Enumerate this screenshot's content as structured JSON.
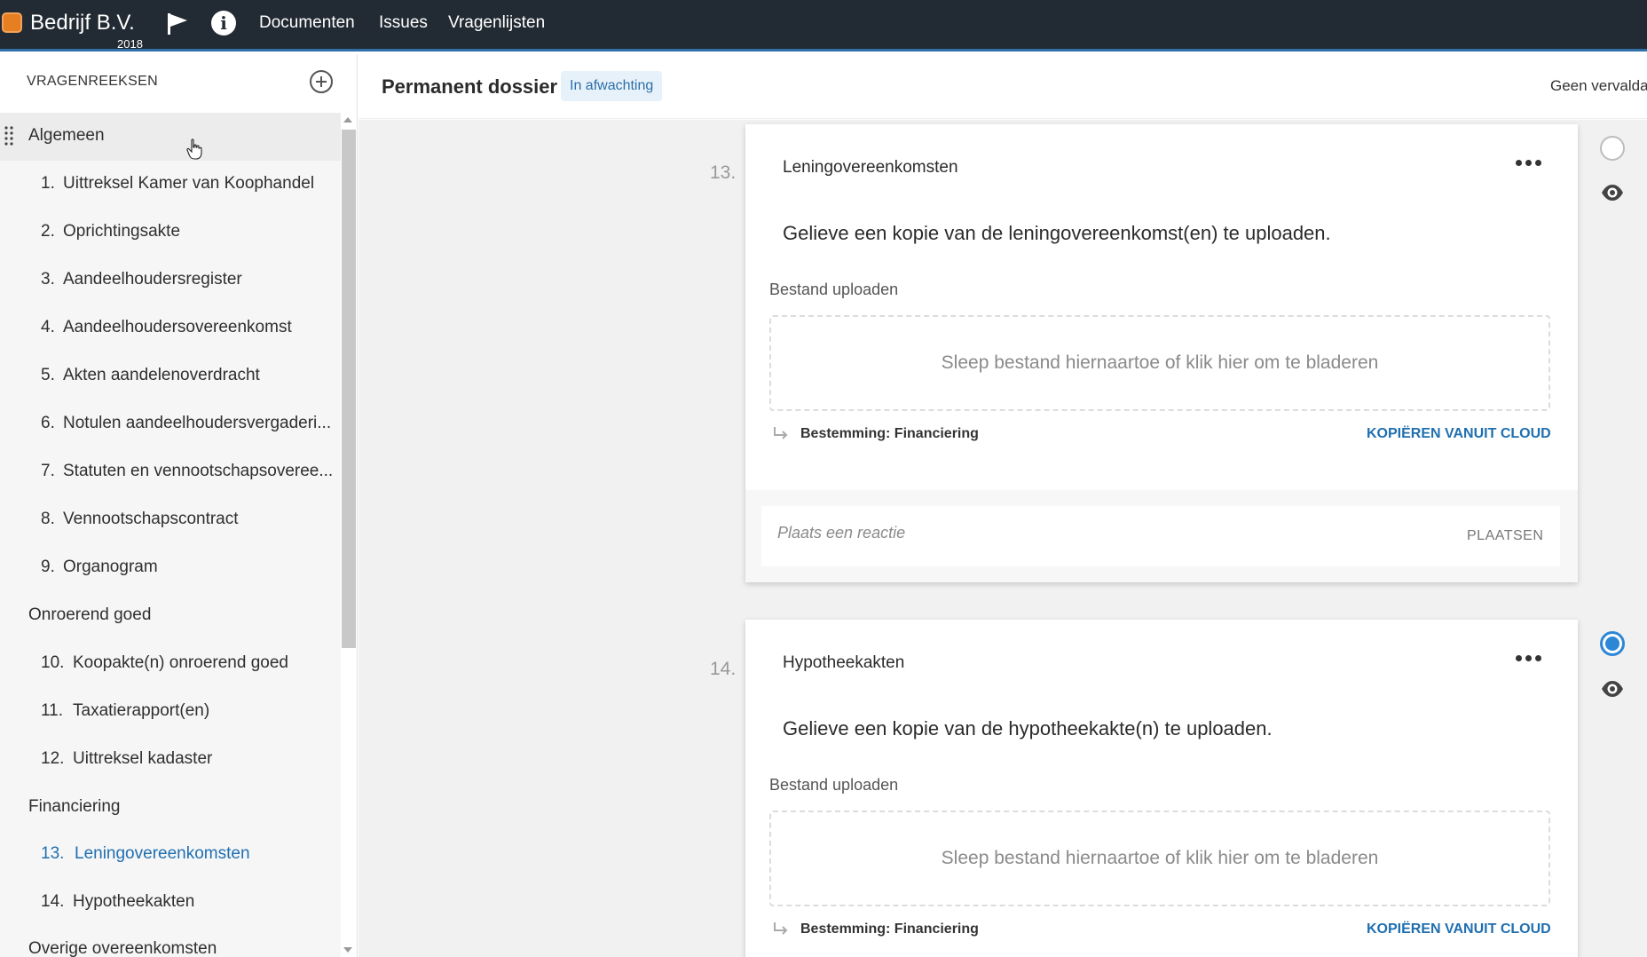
{
  "topbar": {
    "brand_name": "Bedrijf B.V.",
    "brand_year": "2018",
    "nav": [
      "Documenten",
      "Issues",
      "Vragenlijsten"
    ]
  },
  "sidebar": {
    "title": "VRAGENREEKSEN",
    "groups": [
      {
        "label": "Algemeen"
      },
      {
        "label": "Onroerend goed"
      },
      {
        "label": "Financiering"
      },
      {
        "label": "Overige overeenkomsten"
      }
    ],
    "items": [
      {
        "num": "1.",
        "label": "Uittreksel Kamer van Koophandel"
      },
      {
        "num": "2.",
        "label": "Oprichtingsakte"
      },
      {
        "num": "3.",
        "label": "Aandeelhoudersregister"
      },
      {
        "num": "4.",
        "label": "Aandeelhoudersovereenkomst"
      },
      {
        "num": "5.",
        "label": "Akten aandelenoverdracht"
      },
      {
        "num": "6.",
        "label": "Notulen aandeelhoudersvergaderi..."
      },
      {
        "num": "7.",
        "label": "Statuten en vennootschapsoveree..."
      },
      {
        "num": "8.",
        "label": "Vennootschapscontract"
      },
      {
        "num": "9.",
        "label": "Organogram"
      },
      {
        "num": "10.",
        "label": "Koopakte(n) onroerend goed"
      },
      {
        "num": "11.",
        "label": "Taxatierapport(en)"
      },
      {
        "num": "12.",
        "label": "Uittreksel kadaster"
      },
      {
        "num": "13.",
        "label": "Leningovereenkomsten"
      },
      {
        "num": "14.",
        "label": "Hypotheekakten"
      }
    ],
    "selected_item": "13."
  },
  "header": {
    "title": "Permanent dossier",
    "status": "In afwachting",
    "expiry": "Geen vervaldat"
  },
  "questions": [
    {
      "num": "13.",
      "title": "Leningovereenkomsten",
      "question": "Gelieve een kopie van de leningovereenkomst(en) te uploaden.",
      "upload_label": "Bestand uploaden",
      "dropzone": "Sleep bestand hiernaartoe of klik hier om te bladeren",
      "destination": "Bestemming: Financiering",
      "cloud_link": "KOPIËREN VANUIT CLOUD",
      "comment_placeholder": "Plaats een reactie",
      "comment_button": "PLAATSEN",
      "status_selected": false
    },
    {
      "num": "14.",
      "title": "Hypotheekakten",
      "question": "Gelieve een kopie van de hypotheekakte(n) te uploaden.",
      "upload_label": "Bestand uploaden",
      "dropzone": "Sleep bestand hiernaartoe of klik hier om te bladeren",
      "destination": "Bestemming: Financiering",
      "cloud_link": "KOPIËREN VANUIT CLOUD",
      "status_selected": true
    }
  ],
  "colors": {
    "topbar_bg": "#222a33",
    "accent": "#1f6fb0",
    "brand": "#e67e22",
    "badge_bg": "#e7f1fa",
    "radio_selected": "#2c87d6"
  }
}
